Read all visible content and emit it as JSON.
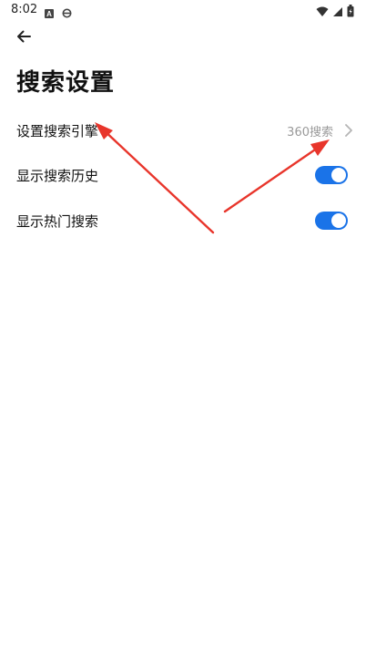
{
  "status_bar": {
    "time": "8:02",
    "icons_left": [
      "a-icon",
      "sync-icon"
    ],
    "icons_right": [
      "wifi-icon",
      "signal-icon",
      "battery-icon"
    ]
  },
  "header": {
    "back_icon": "arrow-left-icon",
    "title": "搜索设置"
  },
  "settings": {
    "items": [
      {
        "label": "设置搜索引擎",
        "value": "360搜索",
        "control": "chevron"
      },
      {
        "label": "显示搜索历史",
        "control": "toggle",
        "checked": true
      },
      {
        "label": "显示热门搜索",
        "control": "toggle",
        "checked": true
      }
    ]
  },
  "colors": {
    "accent": "#1a73e8",
    "annotation_arrow": "#e8352b",
    "secondary_text": "#9a9a9a"
  }
}
